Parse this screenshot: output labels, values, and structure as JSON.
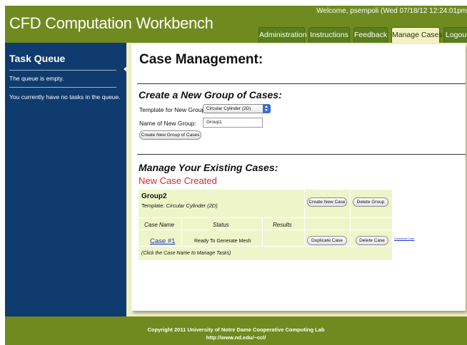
{
  "header": {
    "app_title": "CFD Computation Workbench",
    "welcome": "Welcome, psempoli (Wed 07/18/12 12:24:01pm",
    "tabs": [
      {
        "label": "Administration",
        "active": false
      },
      {
        "label": "Instructions",
        "active": false
      },
      {
        "label": "Feedback",
        "active": false
      },
      {
        "label": "Manage Cases",
        "active": true
      },
      {
        "label": "Logout",
        "active": false
      }
    ]
  },
  "sidebar": {
    "title": "Task Queue",
    "queue_status": "The queue is empty.",
    "task_status": "You currently have no tasks in the queue."
  },
  "main": {
    "page_title": "Case Management:",
    "create_section": {
      "title": "Create a New Group of Cases:",
      "template_label": "Template for New Group:",
      "template_value": "Circular Cylinder (2D)",
      "name_label": "Name of New Group:",
      "name_value": "Group1",
      "create_button": "Create New Group of Cases"
    },
    "manage_section": {
      "title": "Manage Your Existing Cases:",
      "message": "New Case Created",
      "group": {
        "name": "Group2",
        "template_prefix": "Template: ",
        "template_value": "Circular Cylinder (2D)",
        "create_case_button": "Create New Case",
        "delete_group_button": "Delete Group",
        "columns": [
          "Case Name",
          "Status",
          "Results"
        ],
        "rows": [
          {
            "case_name": "Case #1",
            "status": "Ready To Generate Mesh",
            "results": "",
            "duplicate_button": "Duplicate Case",
            "delete_button": "Delete Case",
            "download_link": "Download Case"
          }
        ],
        "hint": "(Click the Case Name to Manage Tasks)"
      }
    }
  },
  "footer": {
    "line1": "Copyright 2011 University of Notre Dame Cooperative Computing Lab",
    "line2": "http://www.nd.edu/~ccl/"
  },
  "colors": {
    "header_green": "#6f8a1f",
    "sidebar_blue": "#0f3b6e",
    "main_background": "#f2efc5",
    "group_background": "#eef6c9",
    "message_red": "#e0262b",
    "link_blue": "#1a33cc"
  }
}
